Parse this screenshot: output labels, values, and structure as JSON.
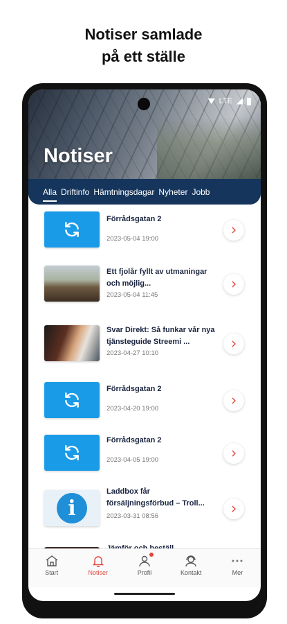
{
  "promo": {
    "line1": "Notiser samlade",
    "line2": "på ett ställe"
  },
  "status": {
    "network": "LTE"
  },
  "header": {
    "title": "Notiser"
  },
  "tabs": [
    {
      "label": "Alla",
      "active": true
    },
    {
      "label": "Driftinfo",
      "active": false
    },
    {
      "label": "Hämtningsdagar",
      "active": false
    },
    {
      "label": "Nyheter",
      "active": false
    },
    {
      "label": "Jobb",
      "active": false
    }
  ],
  "items": [
    {
      "title": "Förrådsgatan 2",
      "date": "2023-05-04 19:00",
      "thumb": "sync-icon"
    },
    {
      "title": "Ett fjolår fyllt av utmaningar och möjlig...",
      "date": "2023-05-04 11:45",
      "thumb": "photo"
    },
    {
      "title": "Svar Direkt: Så funkar vår nya tjänsteguide Streemi ...",
      "date": "2023-04-27 10:10",
      "thumb": "photo"
    },
    {
      "title": "Förrådsgatan 2",
      "date": "2023-04-20 19:00",
      "thumb": "sync-icon"
    },
    {
      "title": "Förrådsgatan 2",
      "date": "2023-04-05 19:00",
      "thumb": "sync-icon"
    },
    {
      "title": "Laddbox får försäljningsförbud – Troll...",
      "date": "2023-03-31 08:56",
      "thumb": "info-icon"
    },
    {
      "title": "Jämför och beställ",
      "date": "",
      "thumb": "photo"
    }
  ],
  "nav": [
    {
      "label": "Start",
      "icon": "home-icon"
    },
    {
      "label": "Notiser",
      "icon": "bell-icon",
      "active": true
    },
    {
      "label": "Profil",
      "icon": "user-icon",
      "badge": true
    },
    {
      "label": "Kontakt",
      "icon": "support-icon"
    },
    {
      "label": "Mer",
      "icon": "more-icon"
    }
  ],
  "colors": {
    "accent": "#e2453b",
    "navy": "#15355c",
    "sync_blue": "#1a9be8"
  }
}
